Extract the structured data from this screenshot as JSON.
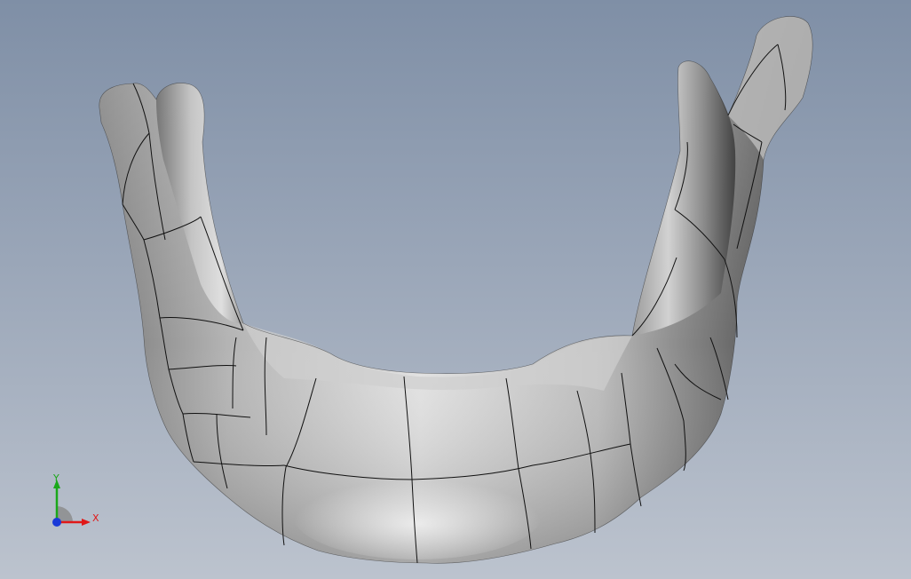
{
  "viewport": {
    "background_top": "#7f8fa6",
    "background_bottom": "#bcc3ce"
  },
  "model": {
    "shade_light": "#e6e6e6",
    "shade_mid": "#a8a8a8",
    "shade_dark": "#4a4a4a",
    "edge_color": "#111111"
  },
  "triad": {
    "x_label": "X",
    "y_label": "Y",
    "x_color": "#e01818",
    "y_color": "#1aa81a",
    "z_color": "#1a3ad8"
  }
}
